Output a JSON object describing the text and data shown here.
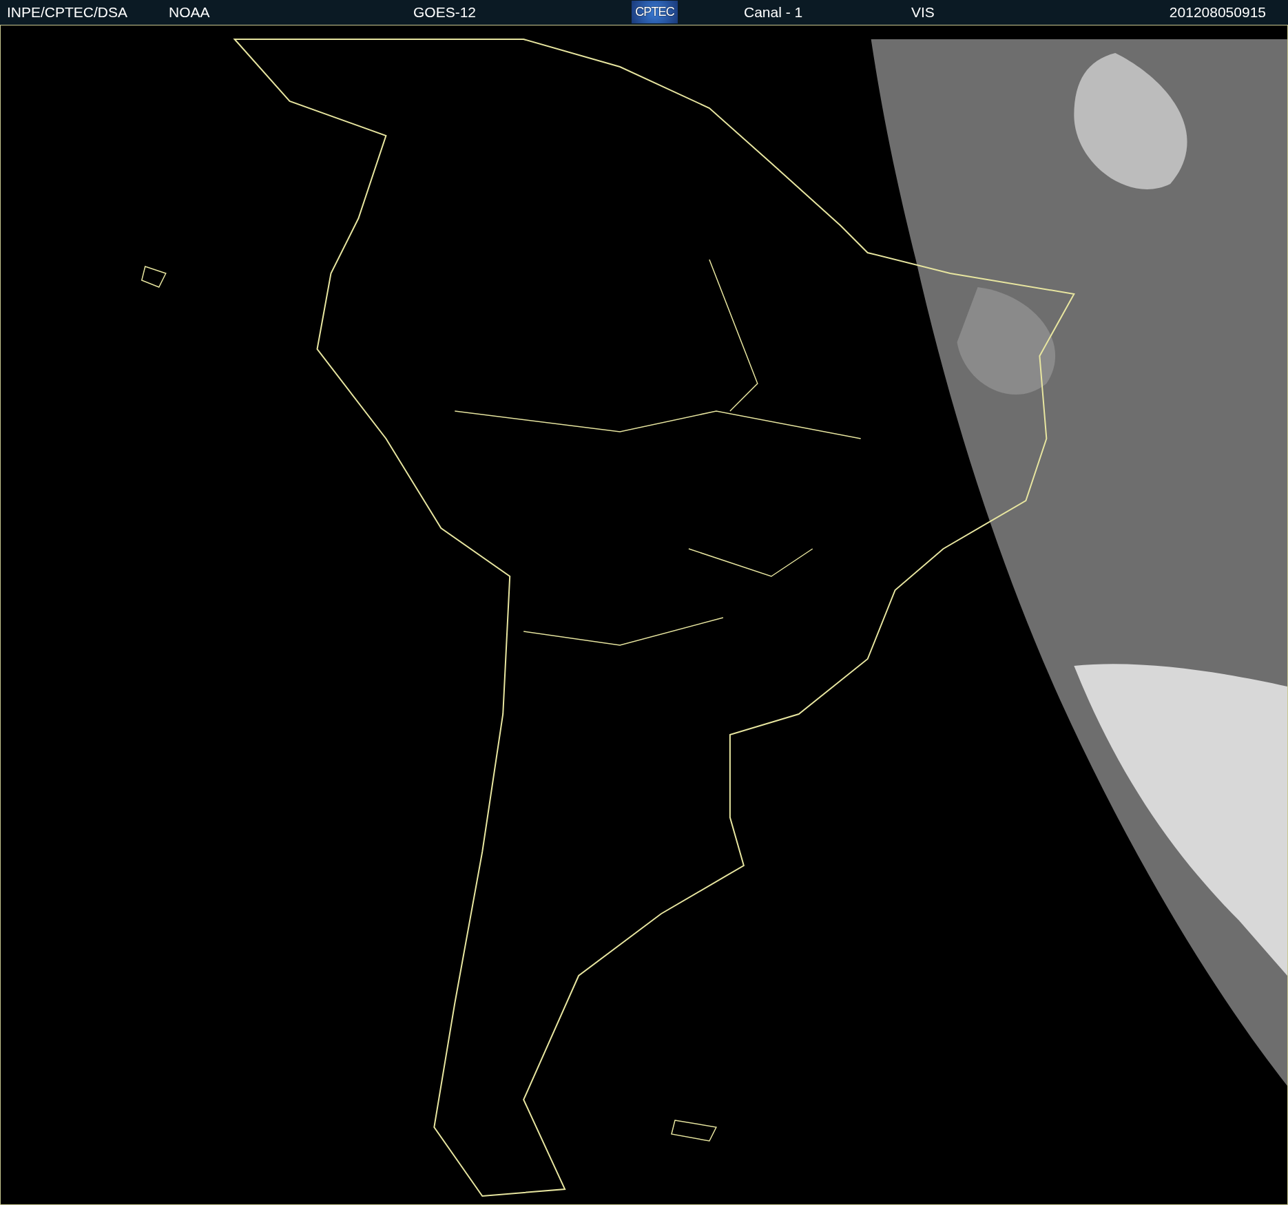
{
  "header": {
    "source": "INPE/CPTEC/DSA",
    "agency": "NOAA",
    "satellite": "GOES-12",
    "logo": "CPTEC",
    "channel": "Canal - 1",
    "band": "VIS",
    "timestamp": "201208050915"
  }
}
